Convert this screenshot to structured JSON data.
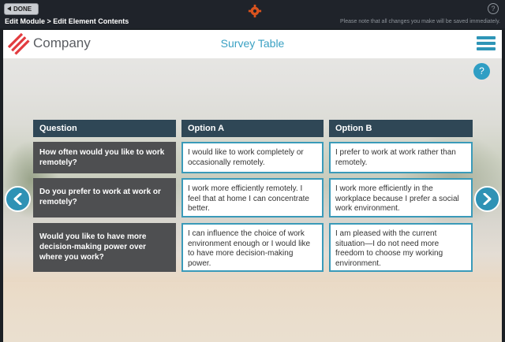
{
  "editor": {
    "done_label": "DONE",
    "breadcrumb": "Edit Module > Edit Element Contents",
    "save_note": "Please note that all changes you make will be saved immediately.",
    "help_label": "?"
  },
  "header": {
    "company": "Company",
    "title": "Survey Table"
  },
  "help_label": "?",
  "table": {
    "columns": [
      "Question",
      "Option A",
      "Option B"
    ],
    "rows": [
      {
        "question": "How often would you like to work remotely?",
        "option_a": "I would like to work completely or occasionally remotely.",
        "option_b": "I prefer to work at work rather than remotely."
      },
      {
        "question": "Do you prefer to work at work or remotely?",
        "option_a": "I work more efficiently remotely. I feel that at home I can concentrate better.",
        "option_b": "I work more efficiently in the workplace because I prefer a social work environment."
      },
      {
        "question": "Would you like to have more decision-making power over where you work?",
        "option_a": "I can influence the choice of work environment enough or I would like to have more decision-making power.",
        "option_b": "I am pleased with the current situation—I do not need more freedom to choose my working environment."
      }
    ]
  },
  "colors": {
    "accent": "#2f92b5",
    "header_cell": "#2f4756",
    "question_cell": "#4e4f51",
    "brand": "#e23b3f"
  },
  "icons": [
    "back-arrow-icon",
    "gear-icon",
    "help-icon",
    "company-logo",
    "menu-icon",
    "chevron-left-icon",
    "chevron-right-icon"
  ]
}
